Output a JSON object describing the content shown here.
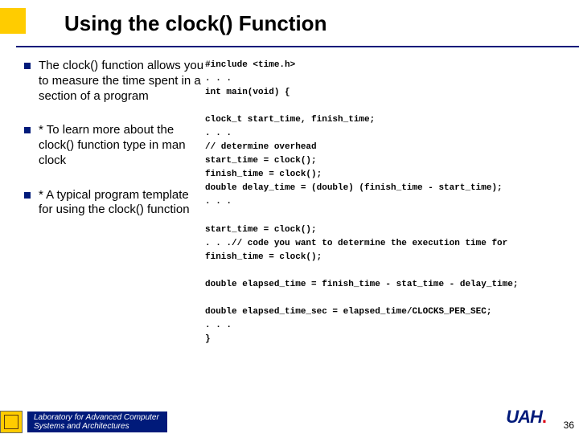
{
  "title": "Using the clock() Function",
  "bullets": [
    "The clock() function allows you to measure the time spent in a section of a program",
    "* To learn more about the clock() function type in man clock",
    "* A typical program template for using the clock() function"
  ],
  "code": "#include <time.h>\n. . .\nint main(void) {\n\nclock_t start_time, finish_time;\n. . .\n// determine overhead\nstart_time = clock();\nfinish_time = clock();\ndouble delay_time = (double) (finish_time - start_time);\n. . .\n\nstart_time = clock();\n. . .// code you want to determine the execution time for\nfinish_time = clock();\n\ndouble elapsed_time = finish_time - stat_time - delay_time;\n\ndouble elapsed_time_sec = elapsed_time/CLOCKS_PER_SEC;\n. . .\n}",
  "footer": {
    "line1": "Laboratory for Advanced Computer",
    "line2": "Systems and Architectures"
  },
  "logo": "UAH",
  "page": "36"
}
